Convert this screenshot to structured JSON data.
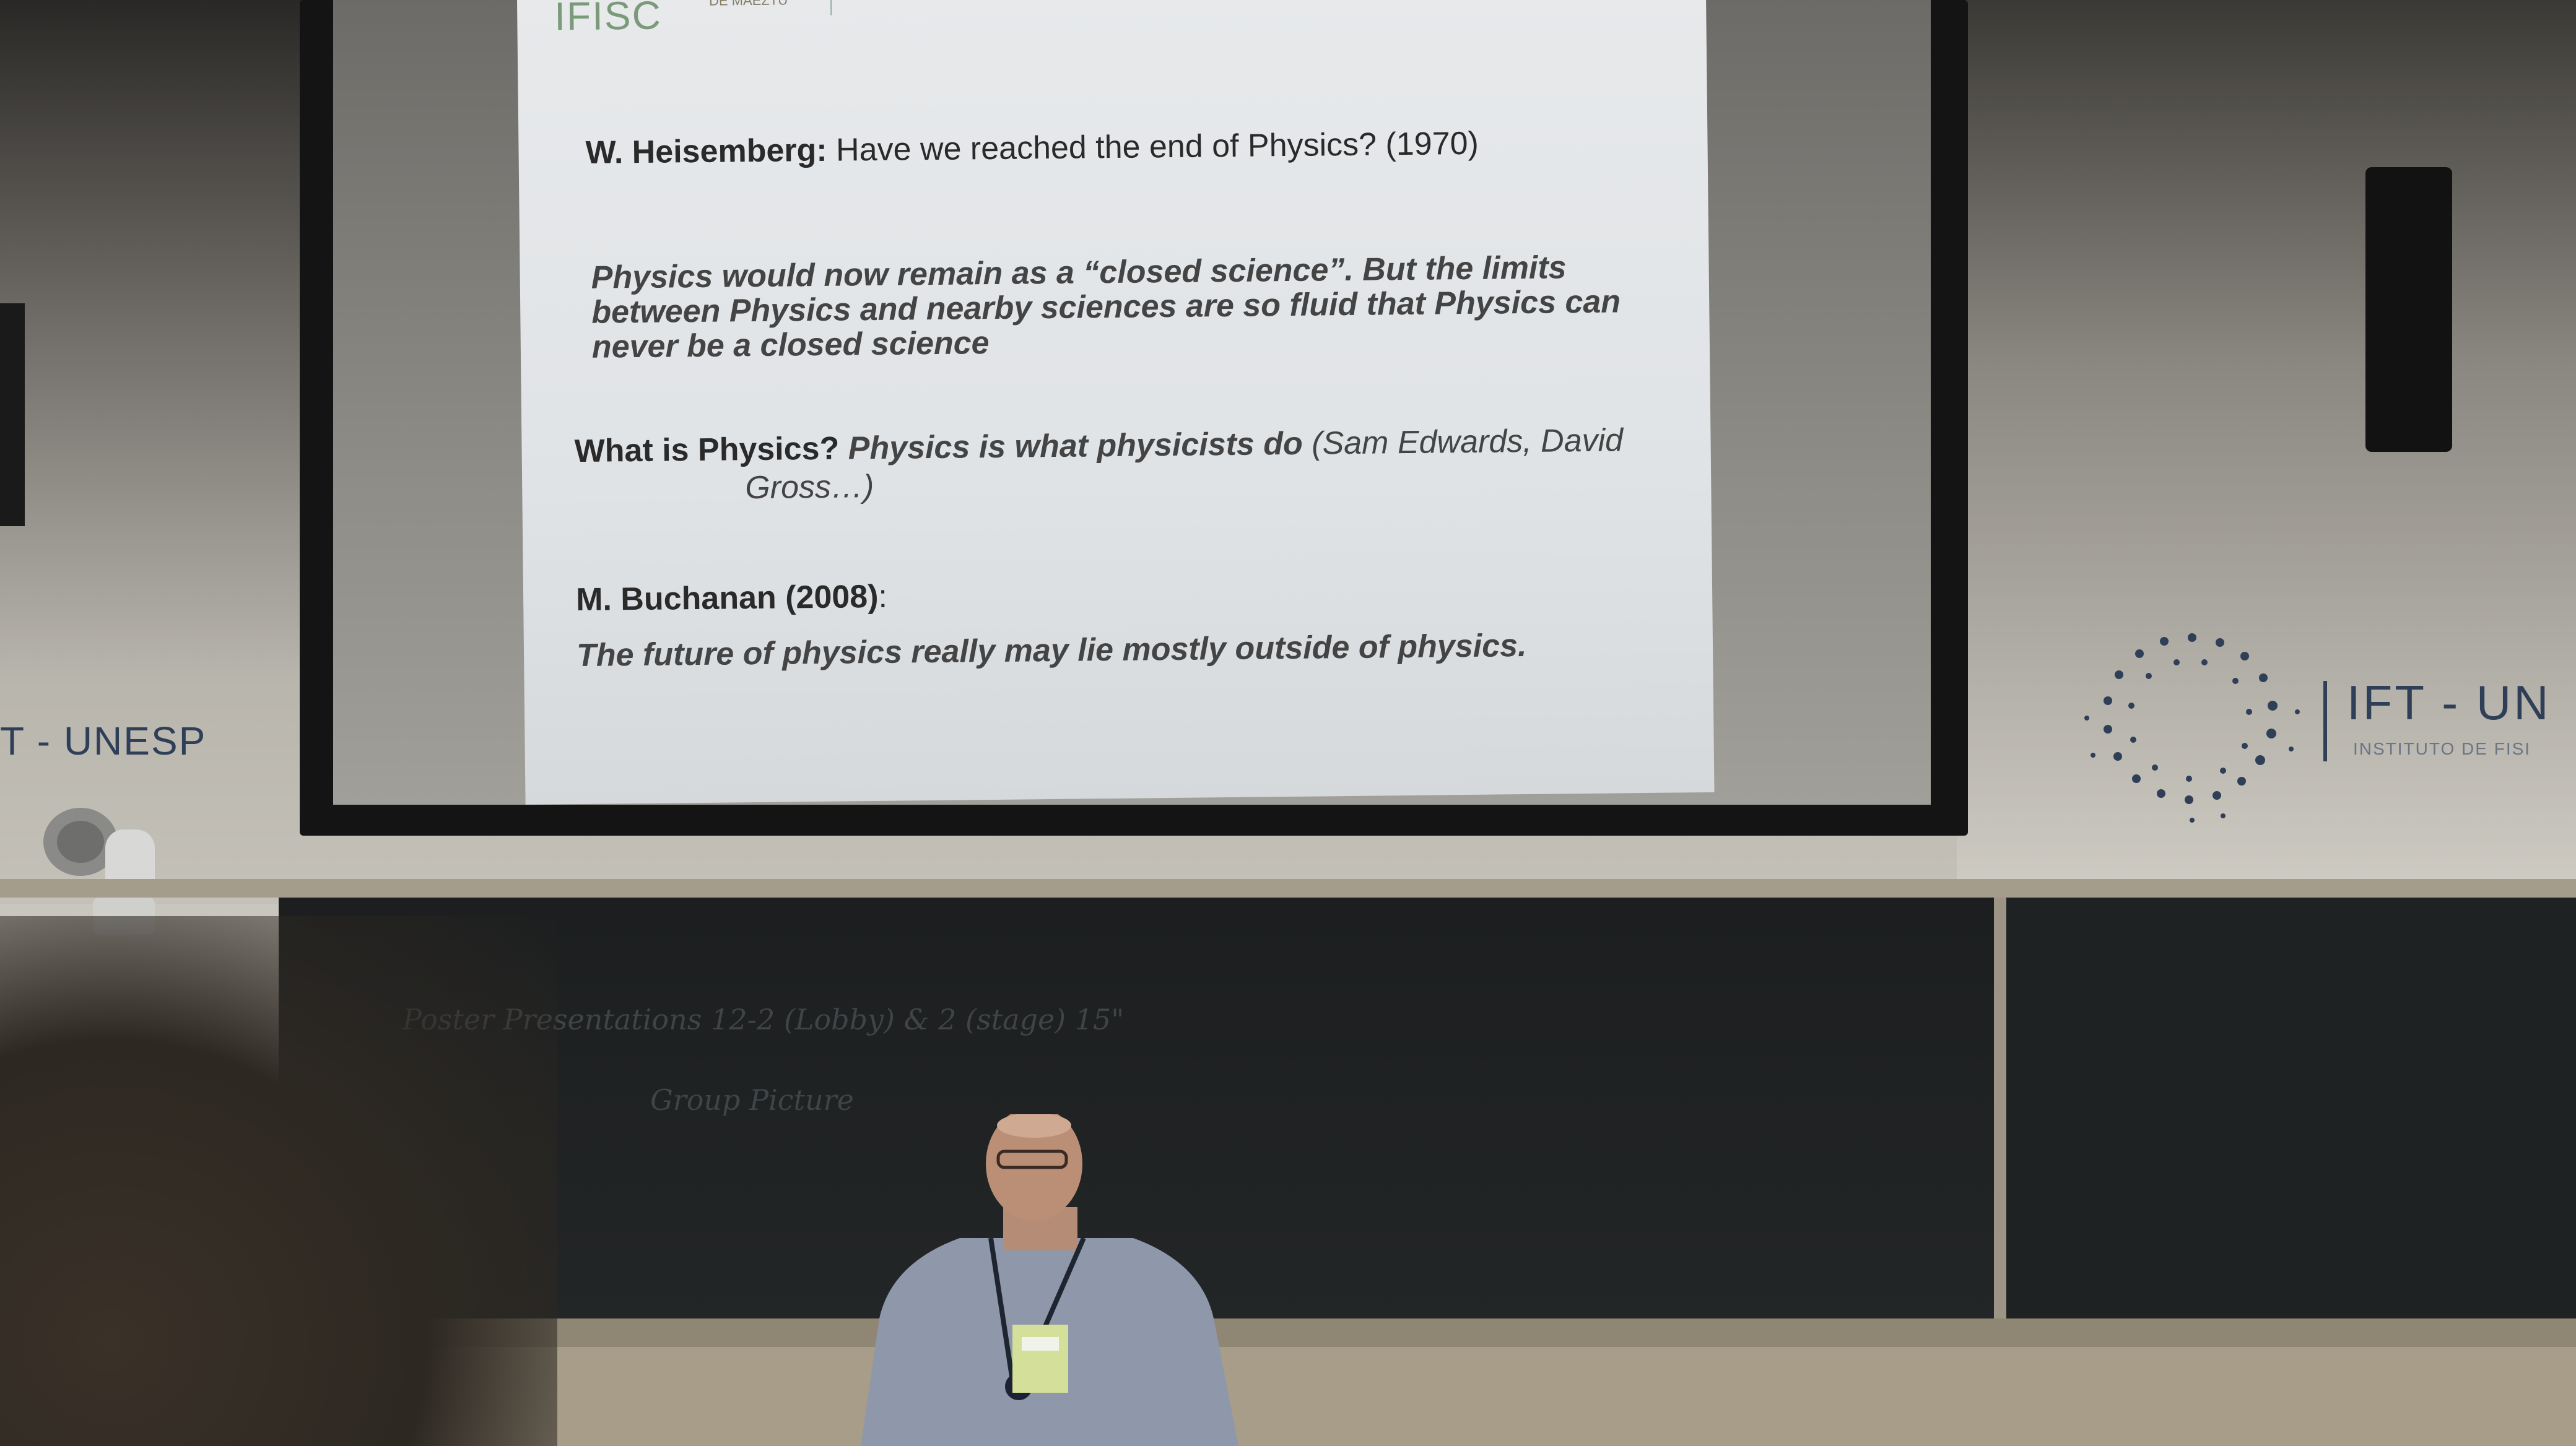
{
  "slide": {
    "logo": "IFISC",
    "logo_sub": "DE MAEZTU",
    "heisenberg_name": "W. Heisemberg:",
    "heisenberg_text": "Have we reached the end of Physics? (1970)",
    "quote_line1": "Physics would now remain as a “closed science”. But the limits",
    "quote_line2": "between Physics and nearby sciences are so fluid that Physics can",
    "quote_line3": "never be a closed science",
    "whatis_label": "What is Physics?",
    "whatis_answer": "Physics is what physicists do",
    "whatis_cite1": "(Sam Edwards, David",
    "whatis_cite2": "Gross…)",
    "buchanan_name": "M. Buchanan (2008)",
    "buchanan_colon": ":",
    "buchanan_quote": "The future of physics really may lie mostly outside of physics."
  },
  "wall": {
    "left_banner": "T - UNESP",
    "right_banner": "IFT - UN",
    "right_banner_sub": "INSTITUTO DE FISI"
  },
  "blackboard": {
    "line1": "Poster Presentations  12-2 (Lobby) & 2 (stage) 15\"",
    "line2": "Group Picture"
  }
}
